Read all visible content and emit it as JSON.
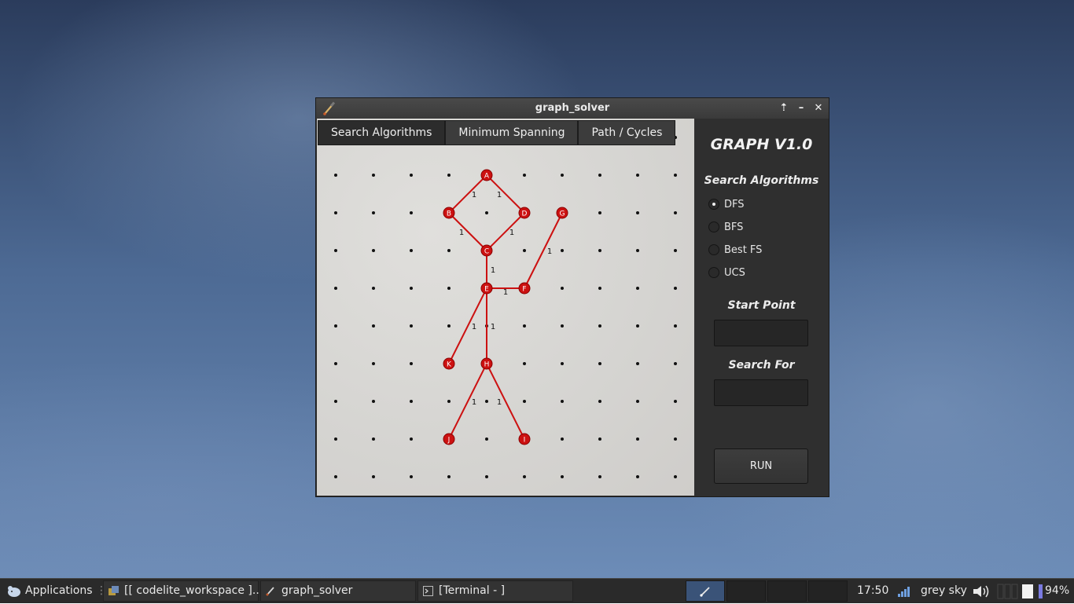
{
  "window": {
    "title": "graph_solver",
    "controls": {
      "maximize": "⇡",
      "minimize": "–",
      "close": "✕"
    }
  },
  "tabs": [
    {
      "label": "Search Algorithms",
      "active": true
    },
    {
      "label": "Minimum Spanning",
      "active": false
    },
    {
      "label": "Path / Cycles",
      "active": false
    }
  ],
  "panel": {
    "heading": "GRAPH V1.0",
    "section_label": "Search Algorithms",
    "options": [
      {
        "label": "DFS",
        "checked": true
      },
      {
        "label": "BFS",
        "checked": false
      },
      {
        "label": "Best FS",
        "checked": false
      },
      {
        "label": "UCS",
        "checked": false
      }
    ],
    "start_label": "Start Point",
    "start_value": "",
    "search_label": "Search For",
    "search_value": "",
    "run_label": "RUN"
  },
  "graph": {
    "grid": {
      "cols": 10,
      "rows": 10
    },
    "node_color": "#cc1111",
    "edge_color": "#cc1111",
    "nodes": [
      {
        "id": "A",
        "col": 4,
        "row": 1
      },
      {
        "id": "B",
        "col": 3,
        "row": 2
      },
      {
        "id": "D",
        "col": 5,
        "row": 2
      },
      {
        "id": "G",
        "col": 6,
        "row": 2
      },
      {
        "id": "C",
        "col": 4,
        "row": 3
      },
      {
        "id": "E",
        "col": 4,
        "row": 4
      },
      {
        "id": "F",
        "col": 5,
        "row": 4
      },
      {
        "id": "K",
        "col": 3,
        "row": 6
      },
      {
        "id": "H",
        "col": 4,
        "row": 6
      },
      {
        "id": "J",
        "col": 3,
        "row": 8
      },
      {
        "id": "I",
        "col": 5,
        "row": 8
      }
    ],
    "edges": [
      {
        "from": "A",
        "to": "B",
        "weight": "1"
      },
      {
        "from": "A",
        "to": "D",
        "weight": "1"
      },
      {
        "from": "B",
        "to": "C",
        "weight": "1"
      },
      {
        "from": "D",
        "to": "C",
        "weight": "1"
      },
      {
        "from": "C",
        "to": "E",
        "weight": "1"
      },
      {
        "from": "E",
        "to": "F",
        "weight": "1"
      },
      {
        "from": "F",
        "to": "G",
        "weight": "1"
      },
      {
        "from": "E",
        "to": "K",
        "weight": "1"
      },
      {
        "from": "E",
        "to": "H",
        "weight": "1"
      },
      {
        "from": "H",
        "to": "J",
        "weight": "1"
      },
      {
        "from": "H",
        "to": "I",
        "weight": "1"
      }
    ]
  },
  "taskbar": {
    "applications_label": "Applications",
    "tasks": [
      {
        "label": "[[ codelite_workspace ]...",
        "icon": "codelite-icon"
      },
      {
        "label": "graph_solver",
        "icon": "paintbrush-icon"
      },
      {
        "label": "[Terminal - ]",
        "icon": "terminal-icon"
      }
    ],
    "workspaces": 4,
    "clock": "17:50",
    "weather": "grey sky",
    "battery": "94%"
  }
}
